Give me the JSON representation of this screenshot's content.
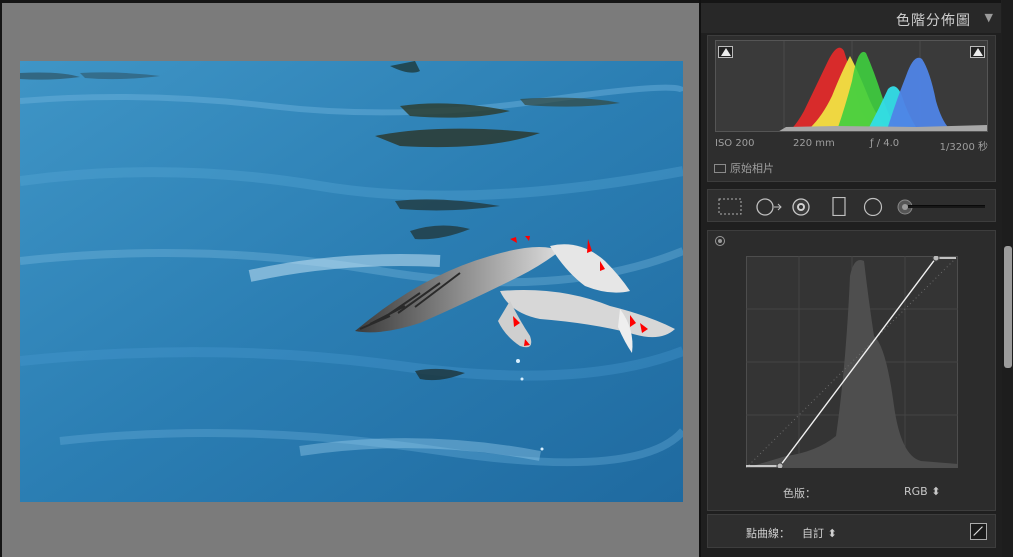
{
  "panel": {
    "title": "色階分佈圖",
    "collapse_icon": "triangle-down"
  },
  "histogram": {
    "iso": "ISO 200",
    "focal_length": "220 mm",
    "aperture": "ƒ / 4.0",
    "shutter": "1/3200 秒",
    "original_photo_label": "原始相片",
    "channel_colors": {
      "red": "#e02a2a",
      "yellow": "#f0e042",
      "green": "#3fcf3f",
      "cyan": "#33dde8",
      "blue": "#4f84e6",
      "gray": "#a8a8a8"
    }
  },
  "tools": [
    "crop-overlay-icon",
    "spot-removal-icon",
    "red-eye-icon",
    "graduated-filter-icon",
    "radial-filter-icon",
    "adjustment-brush-icon"
  ],
  "tone_curve": {
    "channel_label": "色版：",
    "channel_value": "RGB ⬍",
    "point_curve_label": "點曲線：",
    "point_curve_value": "自訂 ⬍",
    "curve_color": "#ffffff"
  },
  "colors": {
    "photo_water": "#2e80b3",
    "clipping_highlight": "#ff0000"
  }
}
